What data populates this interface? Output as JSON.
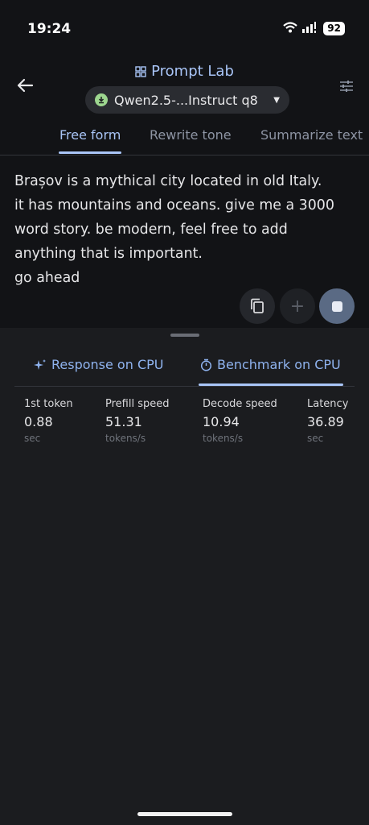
{
  "status": {
    "time": "19:24",
    "battery": "92"
  },
  "header": {
    "title": "Prompt Lab",
    "model": "Qwen2.5-...Instruct q8"
  },
  "tabs": [
    {
      "label": "Free form"
    },
    {
      "label": "Rewrite tone"
    },
    {
      "label": "Summarize text"
    }
  ],
  "prompt": "Brașov is a mythical city located in old Italy.\nit has mountains and oceans. give me a 3000\nword story. be modern, feel free to add\nanything that is important.\ngo ahead",
  "result_tabs": [
    {
      "label": "Response on CPU"
    },
    {
      "label": "Benchmark on CPU"
    }
  ],
  "metrics": [
    {
      "label": "1st token",
      "value": "0.88",
      "unit": "sec"
    },
    {
      "label": "Prefill speed",
      "value": "51.31",
      "unit": "tokens/s"
    },
    {
      "label": "Decode speed",
      "value": "10.94",
      "unit": "tokens/s"
    },
    {
      "label": "Latency",
      "value": "36.89",
      "unit": "sec"
    }
  ],
  "colors": {
    "accent": "#a9c5f7",
    "background": "#1b1c1f",
    "top_background": "#121316"
  }
}
